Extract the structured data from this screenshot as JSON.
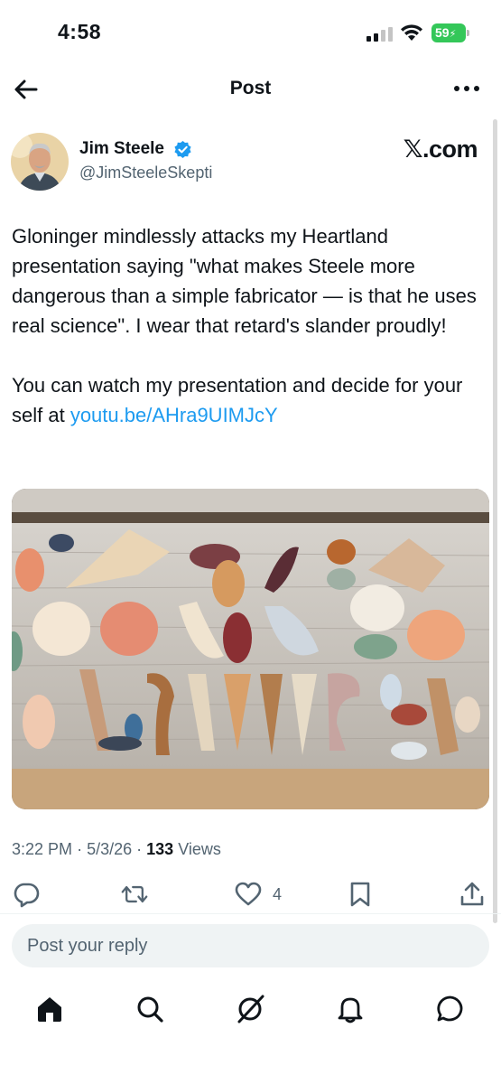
{
  "status_bar": {
    "time": "4:58",
    "battery": "59"
  },
  "nav": {
    "title": "Post"
  },
  "author": {
    "name": "Jim Steele",
    "handle": "@JimSteeleSkepti"
  },
  "brand": {
    "x": "𝕏",
    "suffix": ".com"
  },
  "post": {
    "paragraph1": "Gloninger mindlessly attacks my Heartland presentation saying \"what makes Steele more dangerous than a simple fabricator — is that he uses real science\". I wear that retard's slander proudly!",
    "paragraph2_prefix": "You can watch my presentation and decide for your self at ",
    "link": "youtu.be/AHra9UIMJcY"
  },
  "meta": {
    "time": "3:22 PM",
    "date": "5/3/26",
    "views_count": "133",
    "views_label": "Views",
    "sep": "·"
  },
  "actions": {
    "likes": "4"
  },
  "reply": {
    "placeholder": "Post your reply"
  },
  "icons": [
    "back-arrow-icon",
    "more-icon",
    "verified-badge-icon",
    "reply-icon",
    "repost-icon",
    "like-icon",
    "bookmark-icon",
    "share-icon",
    "home-icon",
    "search-icon",
    "grok-icon",
    "notifications-icon",
    "messages-icon"
  ],
  "colors": {
    "link": "#1d9bf0",
    "verified": "#1d9bf0",
    "battery": "#34c759",
    "secondary_text": "#536471"
  }
}
